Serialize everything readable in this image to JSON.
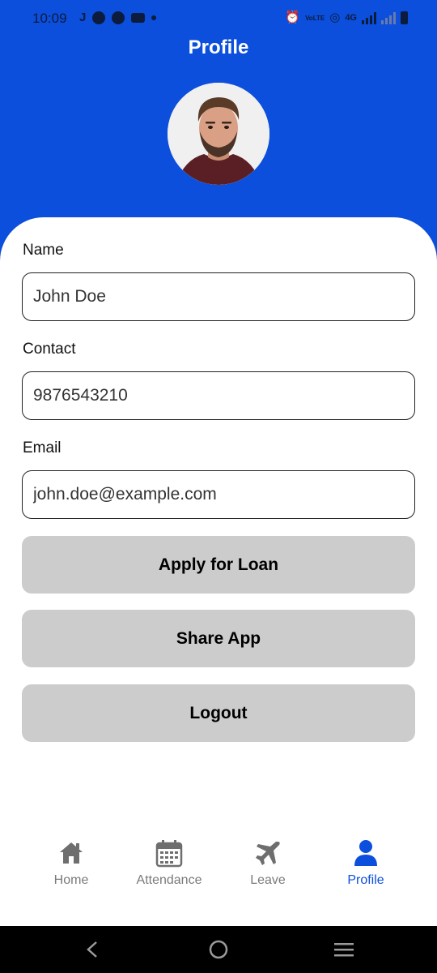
{
  "status_bar": {
    "time": "10:09",
    "left_icons": [
      "j-app-icon",
      "compass-icon",
      "compass-icon",
      "youtube-icon",
      "notification-dot"
    ],
    "network_label": "4G",
    "volte_label": "VoLTE"
  },
  "header": {
    "title": "Profile",
    "background_color": "#0b4fdc"
  },
  "avatar": {
    "icon": "profile-photo"
  },
  "form": {
    "name": {
      "label": "Name",
      "value": "John Doe"
    },
    "contact": {
      "label": "Contact",
      "value": "9876543210"
    },
    "email": {
      "label": "Email",
      "value": "john.doe@example.com"
    }
  },
  "actions": {
    "apply_loan": "Apply for Loan",
    "share_app": "Share App",
    "logout": "Logout"
  },
  "bottom_nav": {
    "items": [
      {
        "label": "Home",
        "icon": "home-icon",
        "active": false
      },
      {
        "label": "Attendance",
        "icon": "calendar-icon",
        "active": false
      },
      {
        "label": "Leave",
        "icon": "airplane-icon",
        "active": false
      },
      {
        "label": "Profile",
        "icon": "user-icon",
        "active": true
      }
    ],
    "active_color": "#0b4fdc",
    "inactive_color": "#7a7a7a"
  },
  "system_nav": {
    "icons": [
      "back-icon",
      "home-circle-icon",
      "recents-icon"
    ]
  }
}
